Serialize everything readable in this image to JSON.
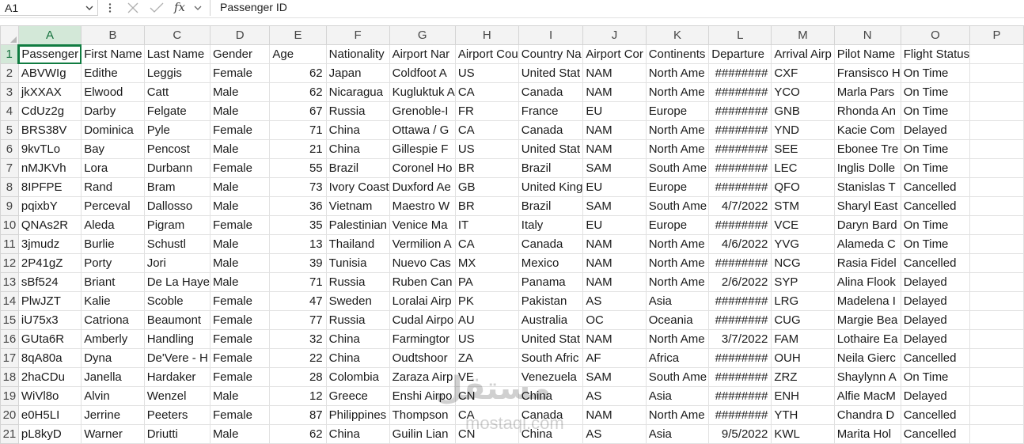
{
  "formula_bar": {
    "name_box": "A1",
    "fx_label": "fx",
    "content": "Passenger ID"
  },
  "columns": [
    "A",
    "B",
    "C",
    "D",
    "E",
    "F",
    "G",
    "H",
    "I",
    "J",
    "K",
    "L",
    "M",
    "N",
    "O",
    "P"
  ],
  "rows": [
    {
      "n": "1",
      "cells": [
        "Passenger",
        "First Name",
        "Last Name",
        "Gender",
        "Age",
        "Nationality",
        "Airport Nar",
        "Airport Cou",
        "Country Na",
        "Airport Cor",
        "Continents",
        "Departure",
        "Arrival Airp",
        "Pilot Name",
        "Flight Status",
        ""
      ]
    },
    {
      "n": "2",
      "cells": [
        "ABVWIg",
        "Edithe",
        "Leggis",
        "Female",
        "62",
        "Japan",
        "Coldfoot A",
        "US",
        "United Stat",
        "NAM",
        "North Ame",
        "########",
        "CXF",
        "Fransisco H",
        "On Time",
        ""
      ]
    },
    {
      "n": "3",
      "cells": [
        "jkXXAX",
        "Elwood",
        "Catt",
        "Male",
        "62",
        "Nicaragua",
        "Kugluktuk A",
        "CA",
        "Canada",
        "NAM",
        "North Ame",
        "########",
        "YCO",
        "Marla Pars",
        "On Time",
        ""
      ]
    },
    {
      "n": "4",
      "cells": [
        "CdUz2g",
        "Darby",
        "Felgate",
        "Male",
        "67",
        "Russia",
        "Grenoble-I",
        "FR",
        "France",
        "EU",
        "Europe",
        "########",
        "GNB",
        "Rhonda An",
        "On Time",
        ""
      ]
    },
    {
      "n": "5",
      "cells": [
        "BRS38V",
        "Dominica",
        "Pyle",
        "Female",
        "71",
        "China",
        "Ottawa / G",
        "CA",
        "Canada",
        "NAM",
        "North Ame",
        "########",
        "YND",
        "Kacie Com",
        "Delayed",
        ""
      ]
    },
    {
      "n": "6",
      "cells": [
        "9kvTLo",
        "Bay",
        "Pencost",
        "Male",
        "21",
        "China",
        "Gillespie F",
        "US",
        "United Stat",
        "NAM",
        "North Ame",
        "########",
        "SEE",
        "Ebonee Tre",
        "On Time",
        ""
      ]
    },
    {
      "n": "7",
      "cells": [
        "nMJKVh",
        "Lora",
        "Durbann",
        "Female",
        "55",
        "Brazil",
        "Coronel Ho",
        "BR",
        "Brazil",
        "SAM",
        "South Ame",
        "########",
        "LEC",
        "Inglis Dolle",
        "On Time",
        ""
      ]
    },
    {
      "n": "8",
      "cells": [
        "8IPFPE",
        "Rand",
        "Bram",
        "Male",
        "73",
        "Ivory Coast",
        "Duxford Ae",
        "GB",
        "United King",
        "EU",
        "Europe",
        "########",
        "QFO",
        "Stanislas T",
        "Cancelled",
        ""
      ]
    },
    {
      "n": "9",
      "cells": [
        "pqixbY",
        "Perceval",
        "Dallosso",
        "Male",
        "36",
        "Vietnam",
        "Maestro W",
        "BR",
        "Brazil",
        "SAM",
        "South Ame",
        "4/7/2022",
        "STM",
        "Sharyl East",
        "Cancelled",
        ""
      ]
    },
    {
      "n": "10",
      "cells": [
        "QNAs2R",
        "Aleda",
        "Pigram",
        "Female",
        "35",
        "Palestinian",
        "Venice Ma",
        "IT",
        "Italy",
        "EU",
        "Europe",
        "########",
        "VCE",
        "Daryn Bard",
        "On Time",
        ""
      ]
    },
    {
      "n": "11",
      "cells": [
        "3jmudz",
        "Burlie",
        "Schustl",
        "Male",
        "13",
        "Thailand",
        "Vermilion A",
        "CA",
        "Canada",
        "NAM",
        "North Ame",
        "4/6/2022",
        "YVG",
        "Alameda C",
        "On Time",
        ""
      ]
    },
    {
      "n": "12",
      "cells": [
        "2P41gZ",
        "Porty",
        "Jori",
        "Male",
        "39",
        "Tunisia",
        "Nuevo Cas",
        "MX",
        "Mexico",
        "NAM",
        "North Ame",
        "########",
        "NCG",
        "Rasia Fidel",
        "Cancelled",
        ""
      ]
    },
    {
      "n": "13",
      "cells": [
        "sBf524",
        "Briant",
        "De La Haye",
        "Male",
        "71",
        "Russia",
        "Ruben Can",
        "PA",
        "Panama",
        "NAM",
        "North Ame",
        "2/6/2022",
        "SYP",
        "Alina Flook",
        "Delayed",
        ""
      ]
    },
    {
      "n": "14",
      "cells": [
        "PlwJZT",
        "Kalie",
        "Scoble",
        "Female",
        "47",
        "Sweden",
        "Loralai Airp",
        "PK",
        "Pakistan",
        "AS",
        "Asia",
        "########",
        "LRG",
        "Madelena I",
        "Delayed",
        ""
      ]
    },
    {
      "n": "15",
      "cells": [
        "iU75x3",
        "Catriona",
        "Beaumont",
        "Female",
        "77",
        "Russia",
        "Cudal Airpo",
        "AU",
        "Australia",
        "OC",
        "Oceania",
        "########",
        "CUG",
        "Margie Bea",
        "Delayed",
        ""
      ]
    },
    {
      "n": "16",
      "cells": [
        "GUta6R",
        "Amberly",
        "Handling",
        "Female",
        "32",
        "China",
        "Farmingtor",
        "US",
        "United Stat",
        "NAM",
        "North Ame",
        "3/7/2022",
        "FAM",
        "Lothaire Ea",
        "Delayed",
        ""
      ]
    },
    {
      "n": "17",
      "cells": [
        "8qA80a",
        "Dyna",
        "De'Vere - H",
        "Female",
        "22",
        "China",
        "Oudtshoor",
        "ZA",
        "South Afric",
        "AF",
        "Africa",
        "########",
        "OUH",
        "Neila Gierc",
        "Cancelled",
        ""
      ]
    },
    {
      "n": "18",
      "cells": [
        "2haCDu",
        "Janella",
        "Hardaker",
        "Female",
        "28",
        "Colombia",
        "Zaraza Airp",
        "VE",
        "Venezuela",
        "SAM",
        "South Ame",
        "########",
        "ZRZ",
        "Shaylynn A",
        "On Time",
        ""
      ]
    },
    {
      "n": "19",
      "cells": [
        "WiVl8o",
        "Alvin",
        "Wenzel",
        "Male",
        "12",
        "Greece",
        "Enshi Airpo",
        "CN",
        "China",
        "AS",
        "Asia",
        "########",
        "ENH",
        "Alfie MacM",
        "Delayed",
        ""
      ]
    },
    {
      "n": "20",
      "cells": [
        "e0H5LI",
        "Jerrine",
        "Peeters",
        "Female",
        "87",
        "Philippines",
        "Thompson",
        "CA",
        "Canada",
        "NAM",
        "North Ame",
        "########",
        "YTH",
        "Chandra D",
        "Cancelled",
        ""
      ]
    },
    {
      "n": "21",
      "cells": [
        "pL8kyD",
        "Warner",
        "Driutti",
        "Male",
        "62",
        "China",
        "Guilin Lian",
        "CN",
        "China",
        "AS",
        "Asia",
        "9/5/2022",
        "KWL",
        "Marita Hol",
        "Cancelled",
        ""
      ]
    }
  ],
  "watermark": {
    "arabic": "مستقل",
    "latin": "mostaql.com"
  },
  "colors": {
    "accent": "#107c41",
    "header_bg": "#f3f3f3",
    "gridline": "#e1e1e1"
  }
}
